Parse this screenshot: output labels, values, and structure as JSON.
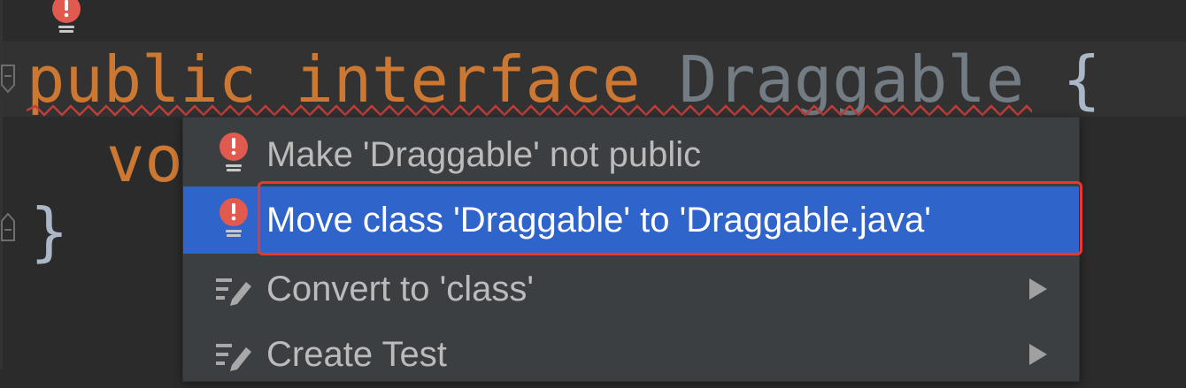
{
  "editor": {
    "line1": {
      "keyword_public": "public",
      "keyword_interface": "interface",
      "class_name": "Draggable",
      "open_brace": "{"
    },
    "line2": {
      "partial_text": "vo"
    },
    "line3": {
      "close_brace": "}"
    }
  },
  "intention_popup": {
    "items": [
      {
        "label": "Make 'Draggable' not public",
        "icon": "red-bulb-icon",
        "has_submenu": false,
        "selected": false
      },
      {
        "label": "Move class 'Draggable' to 'Draggable.java'",
        "icon": "red-bulb-icon",
        "has_submenu": false,
        "selected": true
      },
      {
        "label": "Convert to 'class'",
        "icon": "pencil-edit-icon",
        "has_submenu": true,
        "selected": false
      },
      {
        "label": "Create Test",
        "icon": "pencil-edit-icon",
        "has_submenu": true,
        "selected": false
      }
    ]
  },
  "colors": {
    "editor_bg": "#2b2b2b",
    "keyword": "#cc7832",
    "identifier": "#a9b7c6",
    "error_underline": "#bc3f3c",
    "popup_bg": "#3c3f41",
    "selection": "#2f65ca",
    "bulb_red": "#e05a4f",
    "highlight_border": "#e8382c"
  }
}
